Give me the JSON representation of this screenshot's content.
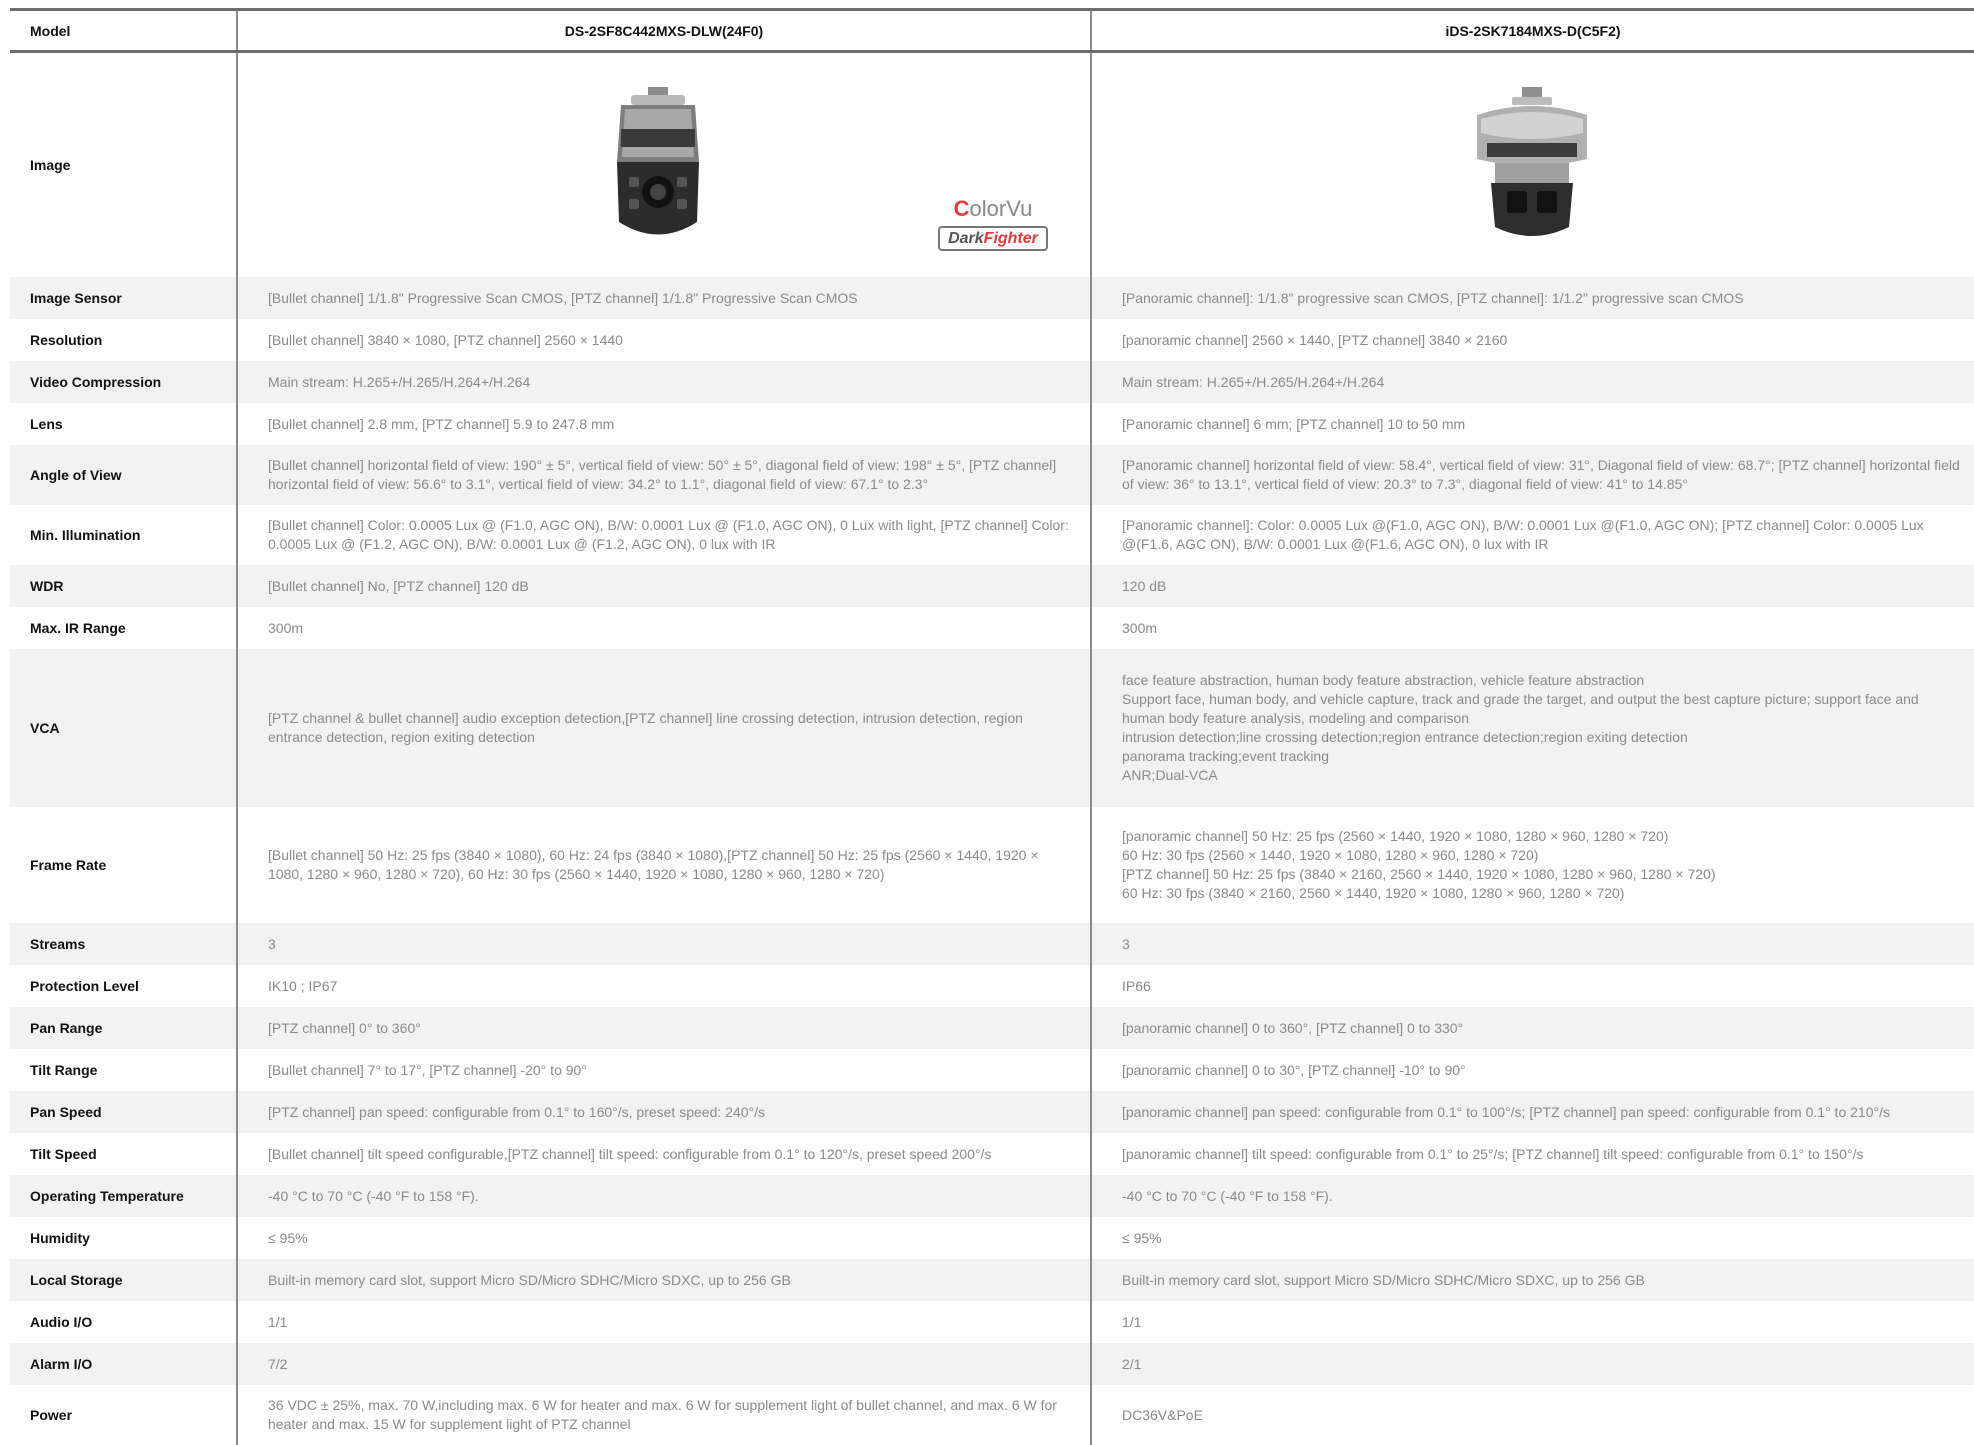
{
  "header": {
    "label": "Model",
    "models": [
      "DS-2SF8C442MXS-DLW(24F0)",
      "iDS-2SK7184MXS-D(C5F2)"
    ]
  },
  "image_row": {
    "label": "Image",
    "badge_colorvu": "ColorVu",
    "badge_darkfighter": "DarkFighter"
  },
  "rows": [
    {
      "label": "Image Sensor",
      "a": "[Bullet channel] 1/1.8\" Progressive Scan CMOS, [PTZ channel] 1/1.8\" Progressive Scan CMOS",
      "b": "[Panoramic channel]: 1/1.8\" progressive scan CMOS, [PTZ channel]: 1/1.2\" progressive scan CMOS"
    },
    {
      "label": "Resolution",
      "a": "[Bullet channel] 3840 × 1080, [PTZ channel] 2560 × 1440",
      "b": " [panoramic channel] 2560 × 1440, [PTZ channel] 3840 × 2160"
    },
    {
      "label": "Video Compression",
      "a": "Main stream: H.265+/H.265/H.264+/H.264",
      "b": "Main stream: H.265+/H.265/H.264+/H.264"
    },
    {
      "label": "Lens",
      "a": "[Bullet channel] 2.8 mm, [PTZ channel] 5.9 to 247.8 mm",
      "b": "[Panoramic channel] 6 mm; [PTZ channel] 10 to 50 mm"
    },
    {
      "label": "Angle of View",
      "a": "[Bullet channel] horizontal field of view: 190° ± 5°, vertical field of view: 50° ± 5°, diagonal field of view: 198° ± 5°, [PTZ channel] horizontal field of view: 56.6° to 3.1°, vertical field of view: 34.2° to 1.1°, diagonal field of view: 67.1° to 2.3°",
      "b": "[Panoramic channel] horizontal field of view: 58.4°, vertical field of view: 31°, Diagonal field of view: 68.7°; [PTZ channel] horizontal field of view: 36° to 13.1°, vertical field of view: 20.3° to 7.3°, diagonal field of view: 41° to 14.85°"
    },
    {
      "label": "Min. Illumination",
      "a": "[Bullet channel] Color: 0.0005 Lux @ (F1.0, AGC ON), B/W: 0.0001 Lux @ (F1.0, AGC ON), 0 Lux with light, [PTZ channel] Color: 0.0005 Lux @ (F1.2, AGC ON), B/W: 0.0001 Lux @ (F1.2, AGC ON), 0 lux with IR",
      "b": "[Panoramic channel]: Color: 0.0005 Lux @(F1.0, AGC ON), B/W: 0.0001 Lux @(F1.0, AGC ON); [PTZ channel] Color: 0.0005 Lux @(F1.6, AGC ON), B/W: 0.0001 Lux @(F1.6, AGC ON), 0 lux with IR"
    },
    {
      "label": "WDR",
      "a": "[Bullet channel] No, [PTZ channel] 120 dB",
      "b": "120 dB"
    },
    {
      "label": "Max. IR Range",
      "a": "300m",
      "b": "300m"
    },
    {
      "label": "VCA",
      "a": "[PTZ channel & bullet channel] audio exception detection,[PTZ channel] line crossing detection, intrusion detection, region entrance detection, region exiting detection",
      "b_lines": [
        "face feature abstraction, human body feature abstraction, vehicle feature abstraction",
        "Support face, human body, and vehicle capture, track and grade the target, and output the best capture picture; support face and human body feature analysis, modeling and comparison",
        "intrusion detection;line crossing detection;region entrance detection;region exiting detection",
        "panorama tracking;event tracking",
        "ANR;Dual-VCA"
      ]
    },
    {
      "label": "Frame Rate",
      "a": "[Bullet channel] 50 Hz: 25 fps (3840 × 1080), 60 Hz: 24 fps (3840 × 1080),[PTZ channel] 50 Hz: 25 fps (2560 × 1440, 1920 × 1080, 1280 × 960, 1280 × 720), 60 Hz: 30 fps (2560 × 1440, 1920 × 1080, 1280 × 960, 1280 × 720)",
      "b_lines": [
        "[panoramic channel] 50 Hz: 25 fps (2560 × 1440, 1920 × 1080, 1280 × 960, 1280 × 720)",
        "60 Hz: 30 fps (2560 × 1440, 1920 × 1080, 1280 × 960, 1280 × 720)",
        "[PTZ channel] 50 Hz: 25 fps (3840 × 2160, 2560 × 1440, 1920 × 1080, 1280 × 960, 1280 × 720)",
        "60 Hz: 30 fps (3840 × 2160, 2560 × 1440, 1920 × 1080, 1280 × 960, 1280 × 720)"
      ]
    },
    {
      "label": "Streams",
      "a": "3",
      "b": "3"
    },
    {
      "label": "Protection Level",
      "a": "IK10 ; IP67",
      "b": "IP66"
    },
    {
      "label": "Pan Range",
      "a": " [PTZ channel] 0° to 360°",
      "b": "[panoramic channel] 0 to 360°, [PTZ channel] 0 to 330°"
    },
    {
      "label": "Tilt Range",
      "a": "[Bullet channel] 7° to 17°, [PTZ channel] -20° to 90°",
      "b": "[panoramic channel] 0 to 30°, [PTZ channel] -10° to 90°"
    },
    {
      "label": "Pan Speed",
      "a": "[PTZ channel] pan speed: configurable from 0.1° to 160°/s, preset speed: 240°/s",
      "b": "[panoramic channel] pan speed: configurable from 0.1° to 100°/s; [PTZ channel] pan speed: configurable from 0.1° to 210°/s"
    },
    {
      "label": "Tilt Speed",
      "a": "[Bullet channel] tilt speed configurable,[PTZ channel] tilt speed: configurable from 0.1° to 120°/s, preset speed 200°/s",
      "b": "[panoramic channel] tilt speed: configurable from 0.1° to 25°/s; [PTZ channel] tilt speed: configurable from 0.1° to 150°/s"
    },
    {
      "label": "Operating Temperature",
      "a": "-40 °C to 70 °C (-40 °F to 158 °F).",
      "b": "-40 °C to 70 °C (-40 °F to 158 °F)."
    },
    {
      "label": "Humidity",
      "a": "≤ 95%",
      "b": "≤ 95%"
    },
    {
      "label": "Local Storage",
      "a": "Built-in memory card slot, support Micro SD/Micro SDHC/Micro SDXC, up to 256 GB",
      "b": "Built-in memory card slot, support Micro SD/Micro SDHC/Micro SDXC, up to 256 GB"
    },
    {
      "label": "Audio I/O",
      "a": "1/1",
      "b": "1/1"
    },
    {
      "label": "Alarm I/O",
      "a": "7/2",
      "b": "2/1"
    },
    {
      "label": "Power",
      "a": "36 VDC ± 25%, max. 70 W,including max. 6 W for heater and max. 6 W for supplement light of bullet channel, and max. 6 W for heater and max. 15 W for supplement light of PTZ channel",
      "b": "DC36V&PoE"
    }
  ]
}
